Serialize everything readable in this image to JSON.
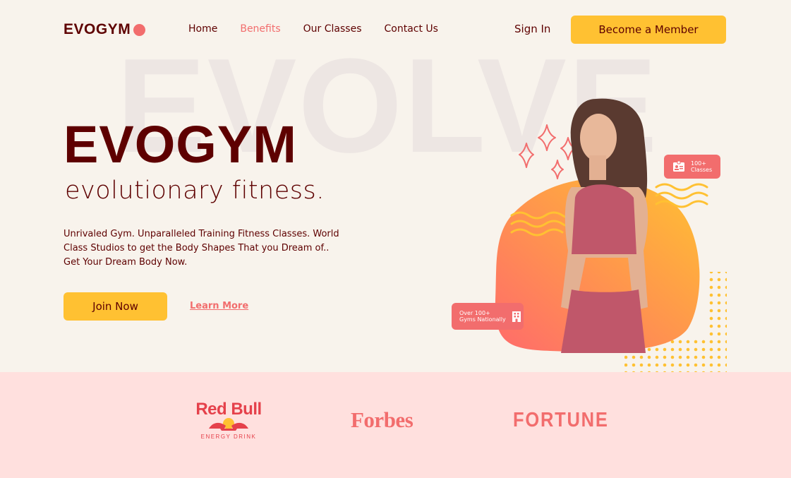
{
  "header": {
    "logo": "EVOGYM",
    "nav": [
      {
        "label": "Home",
        "active": false
      },
      {
        "label": "Benefits",
        "active": true
      },
      {
        "label": "Our Classes",
        "active": false
      },
      {
        "label": "Contact Us",
        "active": false
      }
    ],
    "sign_in": "Sign In",
    "member_button": "Become a Member"
  },
  "hero": {
    "background_word": "EVOLVE",
    "title": "EVOGYM",
    "subtitle": "evolutionary fitness.",
    "description": "Unrivaled Gym. Unparalleled Training Fitness Classes. World Class Studios to get the Body Shapes That you Dream of.. Get Your Dream Body Now.",
    "join_button": "Join Now",
    "learn_more": "Learn More"
  },
  "badges": {
    "classes_line1": "100+",
    "classes_line2": "Classes",
    "gyms_line1": "Over 100+",
    "gyms_line2": "Gyms Nationally"
  },
  "sponsors": {
    "redbull_name": "Red Bull",
    "redbull_tagline": "ENERGY DRINK",
    "forbes": "Forbes",
    "fortune": "FORTUNE"
  },
  "colors": {
    "background": "#f8f3ec",
    "primary_text": "#5e0000",
    "accent_coral": "#f26d6d",
    "accent_yellow": "#ffc132",
    "sponsor_band": "#ffe0de"
  }
}
